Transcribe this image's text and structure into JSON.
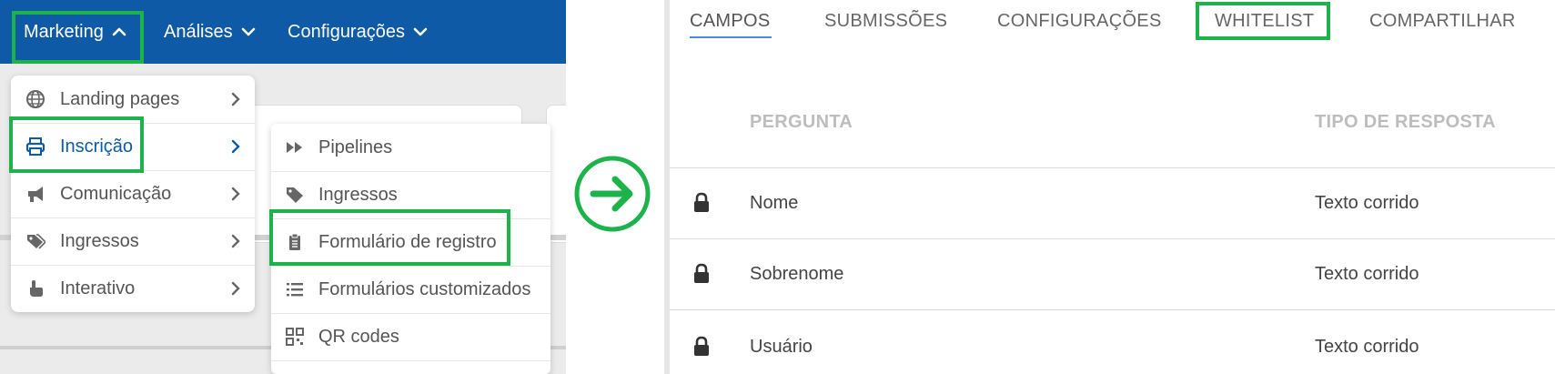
{
  "left": {
    "nav": {
      "items": [
        {
          "label": "Marketing",
          "chevron": "up"
        },
        {
          "label": "Análises",
          "chevron": "down"
        },
        {
          "label": "Configurações",
          "chevron": "down"
        }
      ]
    },
    "menu": {
      "items": [
        {
          "label": "Landing pages",
          "icon": "globe-icon"
        },
        {
          "label": "Inscrição",
          "icon": "printer-icon"
        },
        {
          "label": "Comunicação",
          "icon": "megaphone-icon"
        },
        {
          "label": "Ingressos",
          "icon": "tags-icon"
        },
        {
          "label": "Interativo",
          "icon": "hand-pointer-icon"
        }
      ]
    },
    "submenu": {
      "items": [
        {
          "label": "Pipelines",
          "icon": "fast-forward-icon"
        },
        {
          "label": "Ingressos",
          "icon": "tag-icon"
        },
        {
          "label": "Formulário de registro",
          "icon": "clipboard-icon"
        },
        {
          "label": "Formulários customizados",
          "icon": "list-icon"
        },
        {
          "label": "QR codes",
          "icon": "qrcode-icon"
        }
      ]
    }
  },
  "right": {
    "tabs": [
      "CAMPOS",
      "SUBMISSÕES",
      "CONFIGURAÇÕES",
      "WHITELIST",
      "COMPARTILHAR"
    ],
    "table": {
      "headers": [
        "PERGUNTA",
        "TIPO DE RESPOSTA"
      ],
      "rows": [
        {
          "pergunta": "Nome",
          "tipo": "Texto corrido"
        },
        {
          "pergunta": "Sobrenome",
          "tipo": "Texto corrido"
        },
        {
          "pergunta": "Usuário",
          "tipo": "Texto corrido"
        }
      ]
    }
  },
  "colors": {
    "nav_blue": "#0e5aa7",
    "highlight_green": "#1db34a",
    "tab_underline": "#4a8fd6"
  }
}
